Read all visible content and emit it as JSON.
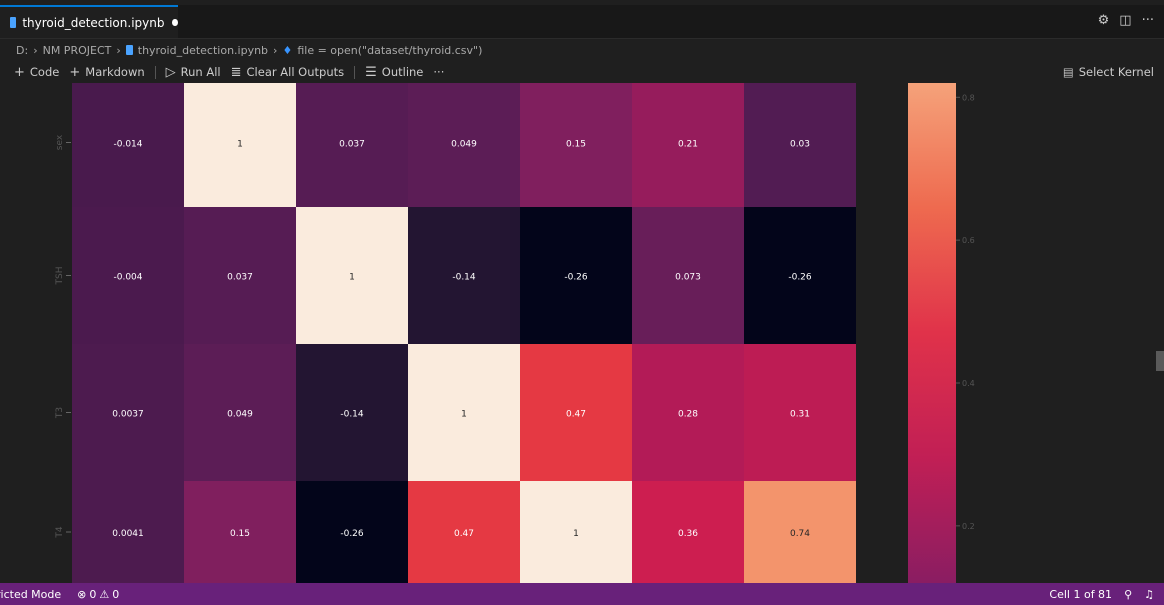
{
  "tab": {
    "filename": "thyroid_detection.ipynb"
  },
  "breadcrumb": {
    "drive": "D:",
    "folder": "NM PROJECT",
    "file": "thyroid_detection.ipynb",
    "cell": "file = open(\"dataset/thyroid.csv\")"
  },
  "toolbar": {
    "code_label": "Code",
    "markdown_label": "Markdown",
    "run_all_label": "Run All",
    "clear_outputs_label": "Clear All Outputs",
    "outline_label": "Outline",
    "more_label": "···",
    "kernel_label": "Select Kernel"
  },
  "chart_data": {
    "type": "heatmap",
    "row_labels": [
      "sex",
      "TSH",
      "T3",
      "T4"
    ],
    "rows": [
      [
        -0.014,
        1,
        0.037,
        0.049,
        0.15,
        0.21,
        0.03
      ],
      [
        -0.004,
        0.037,
        1,
        -0.14,
        -0.26,
        0.073,
        -0.26
      ],
      [
        0.0037,
        0.049,
        -0.14,
        1,
        0.47,
        0.28,
        0.31
      ],
      [
        0.0041,
        0.15,
        -0.26,
        0.47,
        1,
        0.36,
        0.74
      ]
    ],
    "cell_labels": [
      [
        "-0.014",
        "1",
        "0.037",
        "0.049",
        "0.15",
        "0.21",
        "0.03"
      ],
      [
        "-0.004",
        "0.037",
        "1",
        "-0.14",
        "-0.26",
        "0.073",
        "-0.26"
      ],
      [
        "0.0037",
        "0.049",
        "-0.14",
        "1",
        "0.47",
        "0.28",
        "0.31"
      ],
      [
        "0.0041",
        "0.15",
        "-0.26",
        "0.47",
        "1",
        "0.36",
        "0.74"
      ]
    ],
    "colorbar": {
      "ticks": [
        0.8,
        0.6,
        0.4,
        0.2
      ],
      "tick_labels": [
        "0.8",
        "0.6",
        "0.4",
        "0.2"
      ],
      "visible_range": [
        0.12,
        0.82
      ]
    },
    "vmin": -0.26,
    "vmax": 1
  },
  "status": {
    "mode_label": "ricted Mode",
    "errors": "0",
    "warnings": "0",
    "cell_position": "Cell 1 of 81"
  },
  "colors": {
    "statusbar": "#68217a",
    "accent": "#0078d4"
  }
}
